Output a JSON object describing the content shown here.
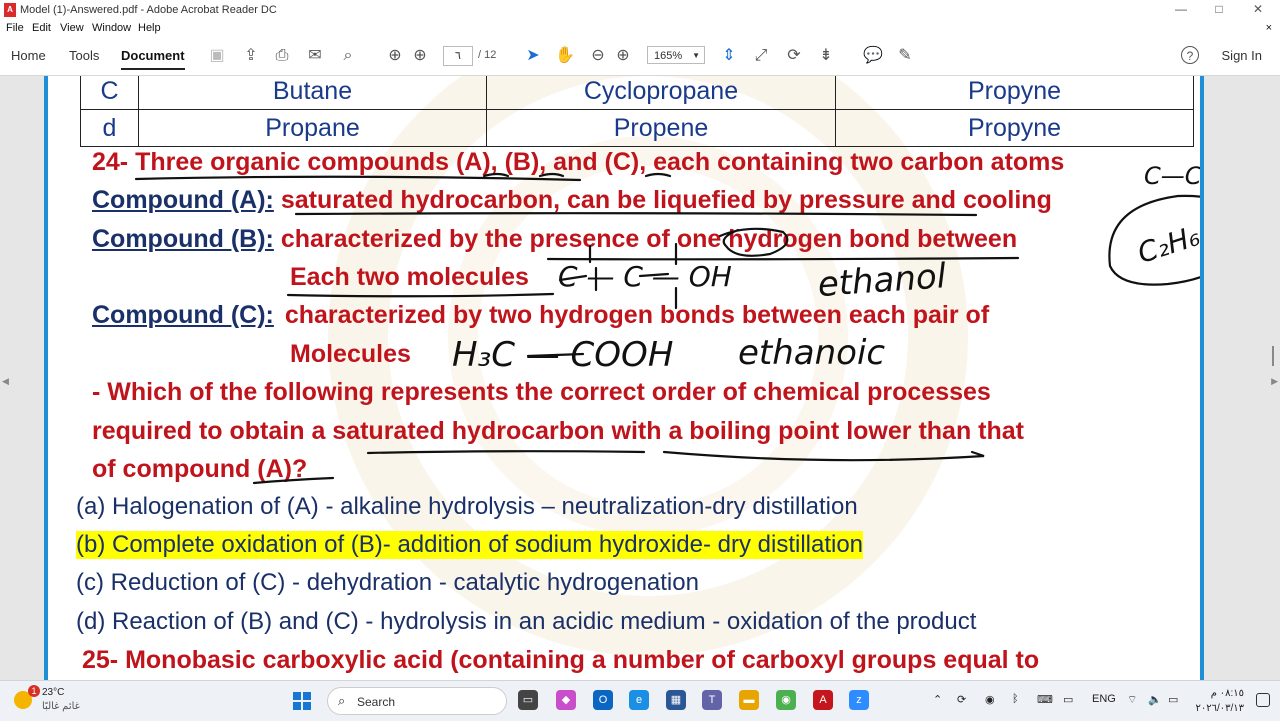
{
  "window": {
    "title": "Model (1)-Answered.pdf - Adobe Acrobat Reader DC",
    "minimize": "—",
    "maximize": "□",
    "close": "✕"
  },
  "menu": [
    "File",
    "Edit",
    "View",
    "Window",
    "Help"
  ],
  "menu_close": "×",
  "toolbar": {
    "tabs": [
      "Home",
      "Tools",
      "Document"
    ],
    "page_current": "٦",
    "page_total": "/ 12",
    "zoom": "165%",
    "help": "?",
    "sign_in": "Sign In"
  },
  "document": {
    "table_rows": [
      [
        "C",
        "Butane",
        "Cyclopropane",
        "Propyne"
      ],
      [
        "d",
        "Propane",
        "Propene",
        "Propyne"
      ]
    ],
    "q24": {
      "number": "24-",
      "stem": "Three organic compounds (A), (B), and (C), each containing two carbon atoms",
      "a_label": "Compound (A):",
      "a_text": "saturated hydrocarbon, can be liquefied by pressure and cooling",
      "b_label": "Compound (B):",
      "b_text1": "characterized by the presence of one hydrogen bond between",
      "b_text2": "Each two molecules",
      "c_label": "Compound (C):",
      "c_text1": "characterized by two hydrogen bonds between each pair of",
      "c_text2": "Molecules",
      "question1": "- Which of the following represents the correct order of chemical processes",
      "question2": "required to obtain a saturated hydrocarbon with a boiling point lower than that",
      "question3": "of compound (A)?",
      "choices": [
        "(a) Halogenation of (A) - alkaline hydrolysis – neutralization-dry distillation",
        "(b) Complete oxidation of (B)- addition of sodium hydroxide- dry distillation",
        "(c) Reduction of (C) - dehydration - catalytic hydrogenation",
        "(d) Reaction of (B) and (C) - hydrolysis in an acidic medium - oxidation of the product"
      ]
    },
    "q25": "25- Monobasic carboxylic acid (containing a number of carboxyl groups equal to",
    "handwriting": {
      "cc": "C—C",
      "c2h6": "C₂H₆",
      "ethanol_formula": "C — C — OH",
      "ethanol": "ethanol",
      "acid_formula": "H₃C — COOH",
      "acid_name": "ethanoic"
    }
  },
  "taskbar": {
    "weather_badge": "1",
    "temp": "23°C",
    "location": "غائم غالبًا",
    "search": "Search",
    "lang": "ENG",
    "time": "٠٨:١٥ م",
    "date": "٢٠٢٦/٠٣/١٣"
  }
}
